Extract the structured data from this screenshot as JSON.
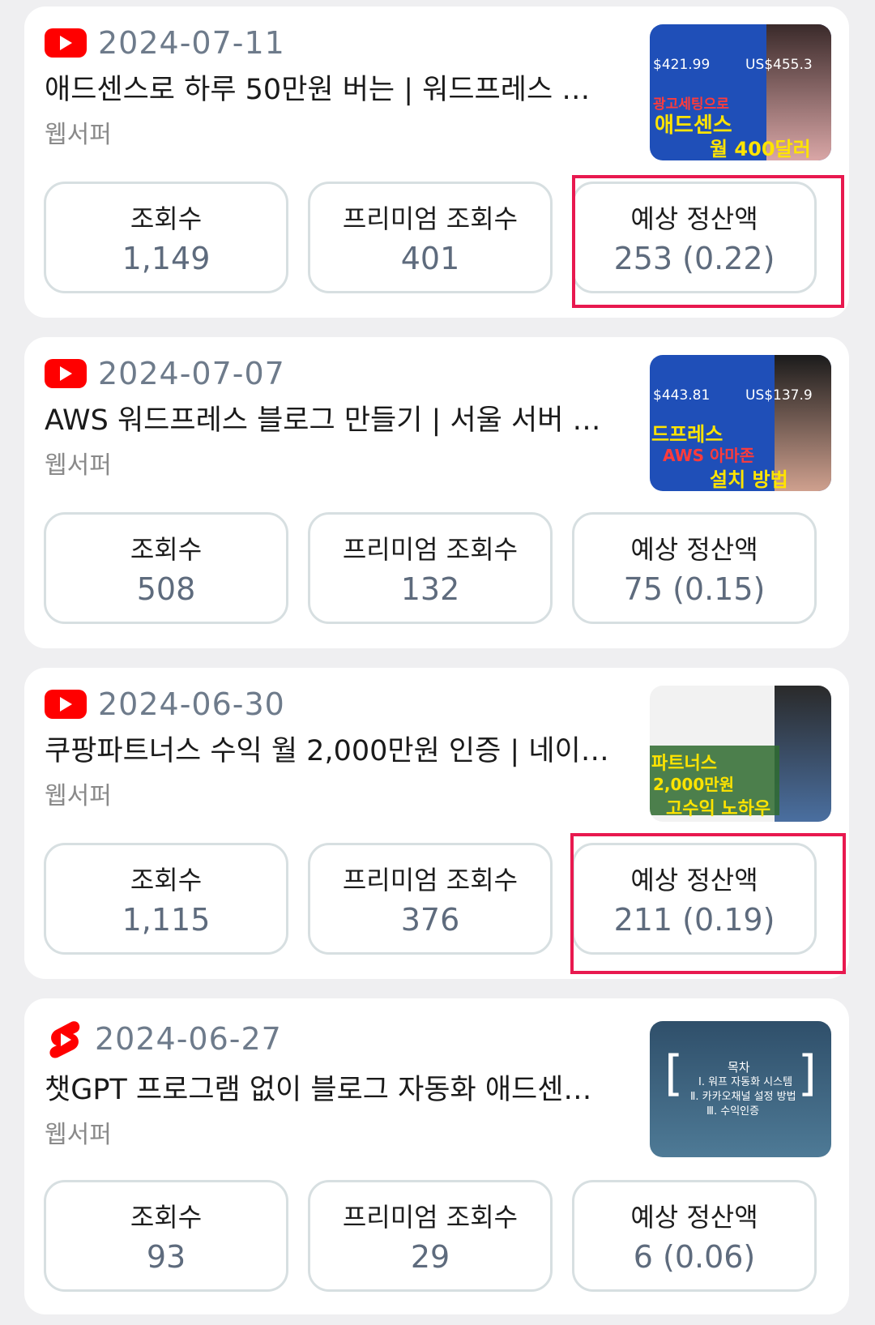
{
  "cards": [
    {
      "icon": "youtube-icon",
      "date": "2024-07-11",
      "title": "애드센스로 하루 50만원 버는 | 워드프레스 …",
      "channel": "웹서퍼",
      "thumbnail": {
        "big": "US$455.3",
        "small": "$421.99",
        "line1": "광고세팅으로",
        "line2": "애드센스",
        "line3": "월 400달러"
      },
      "stats": [
        {
          "label": "조회수",
          "value": "1,149"
        },
        {
          "label": "프리미엄 조회수",
          "value": "401"
        },
        {
          "label": "예상 정산액",
          "value": "253 (0.22)"
        }
      ]
    },
    {
      "icon": "youtube-icon",
      "date": "2024-07-07",
      "title": "AWS 워드프레스 블로그 만들기 | 서울 서버 …",
      "channel": "웹서퍼",
      "thumbnail": {
        "big": "US$137.9",
        "small": "$443.81",
        "line1": "드프레스",
        "line2": "AWS 아마존",
        "line3": "설치 방법"
      },
      "stats": [
        {
          "label": "조회수",
          "value": "508"
        },
        {
          "label": "프리미엄 조회수",
          "value": "132"
        },
        {
          "label": "예상 정산액",
          "value": "75 (0.15)"
        }
      ]
    },
    {
      "icon": "youtube-icon",
      "date": "2024-06-30",
      "title": "쿠팡파트너스 수익 월 2,000만원 인증 | 네이…",
      "channel": "웹서퍼",
      "thumbnail": {
        "big": "",
        "small": "",
        "line1": "파트너스",
        "line2": "2,000만원",
        "line3": "고수익 노하우"
      },
      "stats": [
        {
          "label": "조회수",
          "value": "1,115"
        },
        {
          "label": "프리미엄 조회수",
          "value": "376"
        },
        {
          "label": "예상 정산액",
          "value": "211 (0.19)"
        }
      ]
    },
    {
      "icon": "shorts-icon",
      "date": "2024-06-27",
      "title": "챗GPT 프로그램 없이 블로그 자동화 애드센…",
      "channel": "웹서퍼",
      "thumbnail": {
        "big": "목차",
        "small": "",
        "line1": "Ⅰ. 워프 자동화 시스템",
        "line2": "Ⅱ. 카카오채널 설정 방법",
        "line3": "Ⅲ. 수익인증"
      },
      "stats": [
        {
          "label": "조회수",
          "value": "93"
        },
        {
          "label": "프리미엄 조회수",
          "value": "29"
        },
        {
          "label": "예상 정산액",
          "value": "6 (0.06)"
        }
      ]
    }
  ],
  "colors": {
    "highlight": "#e8194f",
    "youtube": "#ff0000"
  }
}
